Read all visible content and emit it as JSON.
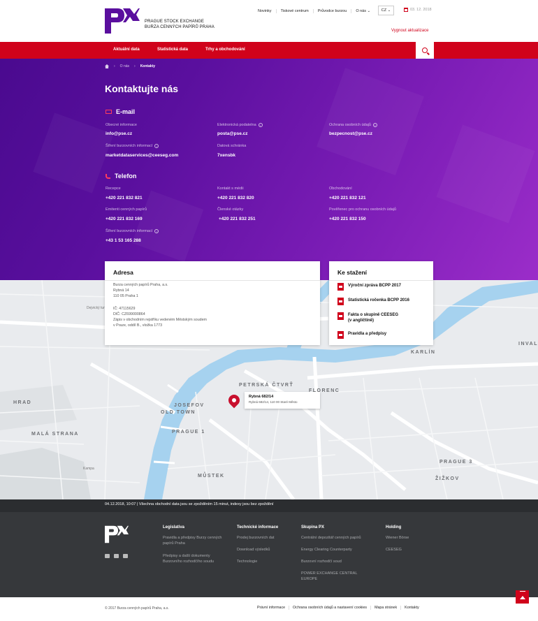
{
  "header": {
    "logo_line1": "PRAGUE STOCK EXCHANGE",
    "logo_line2": "BURZA CENNÝCH PAPÍRŮ PRAHA",
    "top_links": [
      "Novinky",
      "Tiskové centrum",
      "Průvodce burzou",
      "O nás"
    ],
    "lang": "CZ",
    "date": "03. 12. 2018",
    "clear_updates": "Vygnout aktualizace"
  },
  "nav": {
    "items": [
      "Aktuální data",
      "Statistická data",
      "Trhy a obchodování"
    ]
  },
  "breadcrumb": {
    "level1": "O nás",
    "current": "Kontakty"
  },
  "page_title": "Kontaktujte nás",
  "email": {
    "title": "E-mail",
    "items": [
      {
        "label": "Obecné informace",
        "value": "info@pse.cz"
      },
      {
        "label": "Elektronická podatelna",
        "value": "posta@pse.cz"
      },
      {
        "label": "Ochrana osobních údajů",
        "value": "bezpecnost@pse.cz"
      },
      {
        "label": "Šíření burzovních informací",
        "value": "marketdataservices@ceeseg.com"
      },
      {
        "label": "Datová schránka",
        "value": "7xensbk"
      }
    ]
  },
  "phone": {
    "title": "Telefon",
    "items": [
      {
        "label": "Recepce",
        "value": "+420 221 832 821"
      },
      {
        "label": "Kontakt s médii",
        "value": "+420 221 832 820"
      },
      {
        "label": "Obchodování",
        "value": "+420 221 832 121"
      },
      {
        "label": "Emitenti cenných papírů",
        "value": "+420 221 832 169"
      },
      {
        "label": "Členské otázky",
        "value": "+420 221 832 251"
      },
      {
        "label": "Pověřenec pro ochranu osobních údajů",
        "value": "+420 221 832 150"
      },
      {
        "label": "Šíření burzovních informací",
        "value": "+43 1 53 165 288"
      }
    ]
  },
  "address": {
    "title": "Adresa",
    "lines": [
      "Burza cenných papírů Praha, a.s.",
      "Rybná 14",
      "110 05 Praha 1",
      "IČ: 47115629",
      "DIČ: CZ699000864",
      "Zápis v obchodním rejstříku vedeném Městským soudem",
      "v Praze, oddíl B., vložka 1773"
    ]
  },
  "downloads": {
    "title": "Ke stažení",
    "items": [
      "Výroční zpráva BCPP 2017",
      "Statistická ročenka BCPP 2016",
      "Fakta o skupině CEESEG",
      "(v angličtině)",
      "Pravidla a předpisy"
    ]
  },
  "map": {
    "pin_title": "Rybná 682/14",
    "pin_sub": "Rybná 682/14, 110 00 Staré Město",
    "labels": [
      "PETRSKÁ ČTVRŤ",
      "FLORENC",
      "KARLÍN",
      "INVAL",
      "JOSEFOV",
      "OLD TOWN",
      "PRAGUE 1",
      "HRAD",
      "MALÁ STRANA",
      "MŮSTEK",
      "PRAGUE 3",
      "ŽIŽKOV",
      "Kampa",
      "Dejvický tunel"
    ]
  },
  "status": "04.12.2018, 10:07  |  Všechna obchodní data jsou se zpožděním 15 minut, indexy jsou bez zpoždění",
  "footer": {
    "cols": [
      {
        "title": "Legislativa",
        "items": [
          "Pravidla a předpisy Burzy cenných papírů Praha",
          "Předpisy a další dokumenty Burzovního rozhodčího soudu"
        ]
      },
      {
        "title": "Technické informace",
        "items": [
          "Prodej burzovních dat",
          "Download výsledků",
          "Technologie"
        ]
      },
      {
        "title": "Skupina PX",
        "items": [
          "Centrální depozitář cenných papírů",
          "Energy Clearing Counterparty",
          "Burzovní rozhodčí soud",
          "POWER EXCHANGE CENTRAL EUROPE"
        ]
      },
      {
        "title": "Holding",
        "items": [
          "Wiener Börse",
          "CEESEG"
        ]
      }
    ],
    "copyright": "© 2017 Burza cenných papírů Praha, a.s.",
    "bottom_links": [
      "Právní informace",
      "Ochrana osobních údajů a nastavení cookies",
      "Mapa stránek",
      "Kontakty"
    ]
  },
  "colors": {
    "brand_red": "#d0021b",
    "purple": "#5a0f9e",
    "footer_dark": "#36383b"
  }
}
